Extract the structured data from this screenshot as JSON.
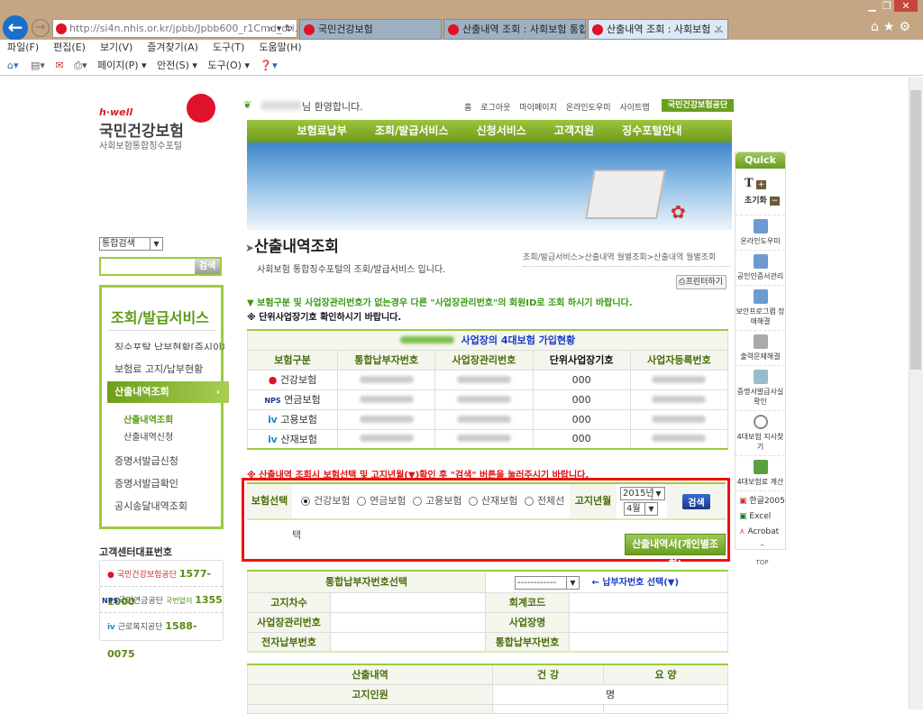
{
  "browser": {
    "url": "http://si4n.nhis.or.kr/jpbb/Jpbb600_r1Cmd_ori.j",
    "tabs": [
      {
        "label": "국민건강보험"
      },
      {
        "label": "산출내역 조회 : 사회보험 통합..."
      },
      {
        "label": "산출내역 조회 : 사회보험 ..."
      }
    ],
    "menu": [
      "파일(F)",
      "편집(E)",
      "보기(V)",
      "즐겨찾기(A)",
      "도구(T)",
      "도움말(H)"
    ],
    "toolbar": [
      "페이지(P) ▾",
      "안전(S) ▾",
      "도구(O) ▾"
    ]
  },
  "site": {
    "logo_brand": "h·well",
    "logo_title": "국민건강보험",
    "logo_sub": "사회보험통합징수포털",
    "welcome": "님 환영합니다.",
    "top_links": [
      "홈",
      "로그아웃",
      "마이페이지",
      "온라인도우미",
      "사이트맵"
    ],
    "top_badge": "국민건강보험공단",
    "nav": [
      "보험료납부",
      "조회/발급서비스",
      "신청서비스",
      "고객지원",
      "징수포털안내"
    ]
  },
  "search": {
    "scope": "통합검색",
    "button": "검색"
  },
  "leftnav": {
    "title": "조회/발급서비스",
    "items": [
      "징수포탈 납부현황[즉시이체, 카드]",
      "보험료 고지/납부현황",
      "산출내역조회",
      "산출내역조회",
      "산출내역신청",
      "증명서발급신청",
      "증명서발급확인",
      "공시송달내역조회"
    ]
  },
  "customer": {
    "title": "고객센터대표번호",
    "rows": [
      {
        "org": "국민건강보험공단",
        "prefix": "",
        "phone": "1577-1000"
      },
      {
        "org": "국민연금공단",
        "prefix": "국번없이",
        "phone": "1355"
      },
      {
        "org": "근로복지공단",
        "prefix": "",
        "phone": "1588-0075"
      }
    ]
  },
  "main": {
    "title": "산출내역조회",
    "subtitle": "사회보험 통합징수포털의 조회/발급서비스 입니다.",
    "breadcrumb": "조회/발급서비스>산출내역 월별조회>산출내역 월별조회",
    "print": "프린터하기",
    "notice1": "▼ 보험구분 및 사업장관리번호가 없는경우 다른 \"사업장관리번호\"의 회원ID로 조회 하시기 바랍니다.",
    "notice2": "※ 단위사업장기호 확인하시기 바랍니다.",
    "table_caption": "사업장의 4대보험 가입현황",
    "columns": [
      "보험구분",
      "통합납부자번호",
      "사업장관리번호",
      "단위사업장기호",
      "사업자등록번호"
    ],
    "rows": [
      {
        "type": "건강보험",
        "unit": "000"
      },
      {
        "type": "연금보험",
        "unit": "000"
      },
      {
        "type": "고용보험",
        "unit": "000"
      },
      {
        "type": "산재보험",
        "unit": "000"
      }
    ],
    "notice3": "※ 산출내역 조회시 보험선택 및 고지년월(▼)확인 후 \"검색\" 버튼을 눌러주시기 바랍니다.",
    "form": {
      "ins_label": "보험선택",
      "options": [
        "건강보험",
        "연금보험",
        "고용보험",
        "산재보험",
        "전체선택"
      ],
      "period_label": "고지년월",
      "year": "2015년",
      "month": "4월",
      "search": "검색",
      "personal": "산출내역서(개인별조회)"
    },
    "detail": {
      "select_label": "통합납부자번호선택",
      "select_value": "------------",
      "select_hint": "← 납부자번호 선택(▼)",
      "labels": [
        "고지차수",
        "회계코드",
        "사업장관리번호",
        "사업장명",
        "전자납부번호",
        "통합납부자번호"
      ]
    },
    "calc": {
      "headers": [
        "산출내역",
        "건 강",
        "요 양"
      ],
      "row_label": "고지인원",
      "unit": "명"
    }
  },
  "quick": {
    "title": "Quick",
    "reset": "초기화",
    "items": [
      "온라인도우미",
      "공인인증서관리",
      "보안프로그램 장애해결",
      "출력문제해결",
      "증명서발급사실 확인",
      "4대보험 지사찾기",
      "4대보험료 계산"
    ],
    "files": [
      "한글2005",
      "Excel",
      "Acrobat"
    ],
    "top": "TOP"
  }
}
